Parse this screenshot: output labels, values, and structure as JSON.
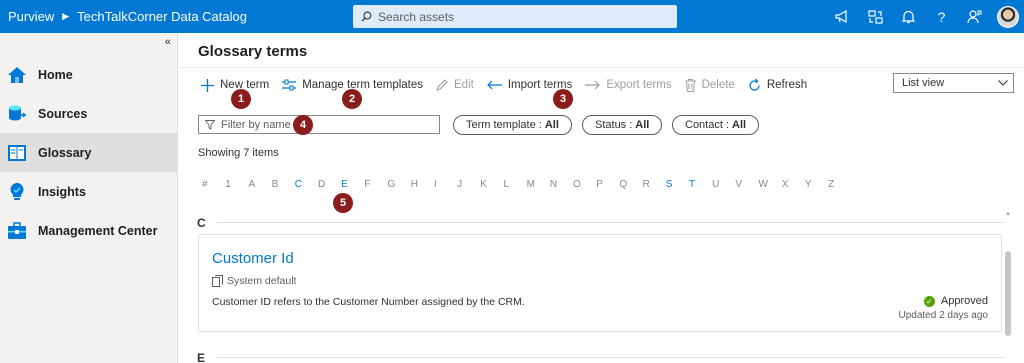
{
  "header": {
    "app_name": "Purview",
    "separator": "▶",
    "catalog_name": "TechTalkCorner Data Catalog",
    "search_placeholder": "Search assets",
    "help_glyph": "?"
  },
  "sidebar": {
    "collapse_glyph": "«",
    "items": [
      {
        "label": "Home",
        "icon": "home-icon"
      },
      {
        "label": "Sources",
        "icon": "sources-icon"
      },
      {
        "label": "Glossary",
        "icon": "glossary-icon",
        "active": true
      },
      {
        "label": "Insights",
        "icon": "insights-icon"
      },
      {
        "label": "Management Center",
        "icon": "toolbox-icon"
      }
    ]
  },
  "main": {
    "title": "Glossary terms",
    "toolbar": {
      "new_term": "New term",
      "manage_templates": "Manage term templates",
      "edit": "Edit",
      "import_terms": "Import terms",
      "export_terms": "Export terms",
      "delete": "Delete",
      "refresh": "Refresh"
    },
    "view_select": {
      "value": "List view"
    },
    "filter": {
      "placeholder": "Filter by name"
    },
    "pills": {
      "term_template": {
        "label": "Term template :",
        "value": "All"
      },
      "status": {
        "label": "Status :",
        "value": "All"
      },
      "contact": {
        "label": "Contact :",
        "value": "All"
      }
    },
    "showing": "Showing 7 items",
    "alphabet": [
      "#",
      "1",
      "A",
      "B",
      "C",
      "D",
      "E",
      "F",
      "G",
      "H",
      "I",
      "J",
      "K",
      "L",
      "M",
      "N",
      "O",
      "P",
      "Q",
      "R",
      "S",
      "T",
      "U",
      "V",
      "W",
      "X",
      "Y",
      "Z"
    ],
    "alphabet_active": [
      "C",
      "E",
      "S",
      "T"
    ],
    "sections": [
      {
        "letter": "C",
        "terms": [
          {
            "name": "Customer Id",
            "template": "System default",
            "description": "Customer ID refers to the Customer Number assigned by the CRM.",
            "status": "Approved",
            "updated": "Updated 2 days ago"
          }
        ]
      },
      {
        "letter": "E",
        "terms": []
      }
    ],
    "badges": [
      "1",
      "2",
      "3",
      "4",
      "5"
    ]
  },
  "colors": {
    "accent": "#0078d4",
    "badge": "#8b1c1c",
    "approved": "#57a300"
  }
}
